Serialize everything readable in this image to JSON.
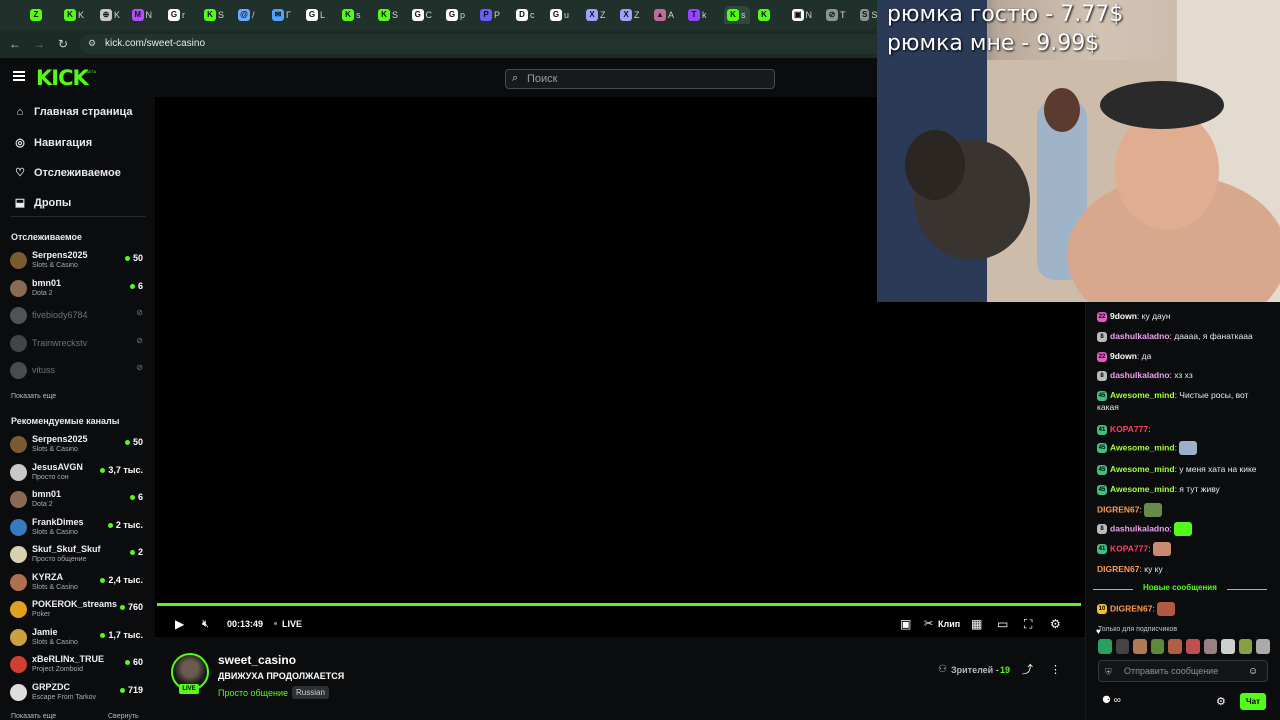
{
  "browser": {
    "url": "kick.com/sweet-casino",
    "tabs": [
      {
        "icon": "Z",
        "label": "",
        "color": "#53fc18"
      },
      {
        "icon": "K",
        "label": "K",
        "color": "#53fc18"
      },
      {
        "icon": "⊕",
        "label": "K",
        "color": "#c9c9c9"
      },
      {
        "icon": "M",
        "label": "N",
        "color": "#b44fff"
      },
      {
        "icon": "G",
        "label": "r",
        "color": "#ffffff"
      },
      {
        "icon": "K",
        "label": "S",
        "color": "#53fc18"
      },
      {
        "icon": "@",
        "label": "/",
        "color": "#6aa9ff"
      },
      {
        "icon": "✉",
        "label": "Г",
        "color": "#4fa3ff"
      },
      {
        "icon": "G",
        "label": "L",
        "color": "#ffffff"
      },
      {
        "icon": "K",
        "label": "s",
        "color": "#53fc18"
      },
      {
        "icon": "K",
        "label": "S",
        "color": "#53fc18"
      },
      {
        "icon": "G",
        "label": "C",
        "color": "#ffffff"
      },
      {
        "icon": "G",
        "label": "p",
        "color": "#ffffff"
      },
      {
        "icon": "P",
        "label": "P",
        "color": "#6a5cff"
      },
      {
        "icon": "D",
        "label": "c",
        "color": "#ffffff"
      },
      {
        "icon": "G",
        "label": "u",
        "color": "#ffffff"
      },
      {
        "icon": "X",
        "label": "Z",
        "color": "#9aa4ff"
      },
      {
        "icon": "X",
        "label": "Z",
        "color": "#9aa4ff"
      },
      {
        "icon": "▲",
        "label": "A",
        "color": "#c26aa0"
      },
      {
        "icon": "T",
        "label": "k",
        "color": "#9146ff"
      },
      {
        "icon": "K",
        "label": "s",
        "color": "#53fc18"
      },
      {
        "icon": "K",
        "label": "",
        "color": "#53fc18"
      },
      {
        "icon": "▣",
        "label": "N",
        "color": "#ffffff"
      },
      {
        "icon": "⊘",
        "label": "T",
        "color": "#8e9297"
      },
      {
        "icon": "S",
        "label": "St",
        "color": "#8e9297"
      }
    ]
  },
  "header": {
    "logo": "KICK",
    "logo_sub": "BETA",
    "search_placeholder": "Поиск"
  },
  "sidebar": {
    "nav": [
      {
        "label": "Главная страница",
        "icon": "⌂"
      },
      {
        "label": "Навигация",
        "icon": "◎"
      },
      {
        "label": "Отслеживаемое",
        "icon": "♡"
      },
      {
        "label": "Дропы",
        "icon": "⬓"
      }
    ],
    "following_title": "Отслеживаемое",
    "following": [
      {
        "name": "Serpens2025",
        "category": "Slots & Casino",
        "viewers": "50",
        "online": true,
        "color": "#7a5a30"
      },
      {
        "name": "bmn01",
        "category": "Dota 2",
        "viewers": "6",
        "online": true,
        "color": "#8a6a55"
      },
      {
        "name": "fivebiody6784",
        "category": "",
        "viewers": "⊘",
        "online": false,
        "color": "#bbbbbb"
      },
      {
        "name": "Trainwreckstv",
        "category": "",
        "viewers": "⊘",
        "online": false,
        "color": "#999999"
      },
      {
        "name": "vituss",
        "category": "",
        "viewers": "⊘",
        "online": false,
        "color": "#aaaaaa"
      }
    ],
    "show_more": "Показать еще",
    "recommended_title": "Рекомендуемые каналы",
    "recommended": [
      {
        "name": "Serpens2025",
        "category": "Slots & Casino",
        "viewers": "50",
        "color": "#7a5a30"
      },
      {
        "name": "JesusAVGN",
        "category": "Просто сон",
        "viewers": "3,7 тыс.",
        "color": "#c9c9c9"
      },
      {
        "name": "bmn01",
        "category": "Dota 2",
        "viewers": "6",
        "color": "#8a6a55"
      },
      {
        "name": "FrankDimes",
        "category": "Slots & Casino",
        "viewers": "2 тыс.",
        "color": "#3a78c0"
      },
      {
        "name": "Skuf_Skuf_Skuf",
        "category": "Просто общение",
        "viewers": "2",
        "color": "#d9d0b0"
      },
      {
        "name": "KYRZA",
        "category": "Slots & Casino",
        "viewers": "2,4 тыс.",
        "color": "#b07050"
      },
      {
        "name": "POKEROK_streams",
        "category": "Poker",
        "viewers": "760",
        "color": "#e0a020"
      },
      {
        "name": "Jamie",
        "category": "Slots & Casino",
        "viewers": "1,7 тыс.",
        "color": "#caa040"
      },
      {
        "name": "xBeRLINx_TRUE",
        "category": "Project Zomboid",
        "viewers": "60",
        "color": "#d04030"
      },
      {
        "name": "GRPZDC",
        "category": "Escape From Tarkov",
        "viewers": "719",
        "color": "#dddddd"
      }
    ],
    "bottom_left": "Показать еще",
    "bottom_right": "Свернуть"
  },
  "player": {
    "time": "00:13:49",
    "live_label": "LIVE",
    "clip_label": "Клип"
  },
  "stream": {
    "streamer": "sweet_casino",
    "live_badge": "LIVE",
    "title": "ДВИЖУХА ПРОДОЛЖАЕТСЯ",
    "category": "Просто общение",
    "language": "Russian",
    "viewers_label": "Зрителей -",
    "viewers_count": "19"
  },
  "overlay": {
    "line1": "рюмка гостю - 7.77$",
    "line2": "рюмка мне - 9.99$"
  },
  "chat": {
    "messages": [
      {
        "badge": "22",
        "badge_color": "#e05cc0",
        "user": "9down",
        "user_color": "#ffffff",
        "text": "ку даун"
      },
      {
        "badge": "8",
        "badge_color": "#bbbbbb",
        "user": "dashulkaladno",
        "user_color": "#f0a0f0",
        "text": "даааа, я фанаткааа"
      },
      {
        "badge": "22",
        "badge_color": "#e05cc0",
        "user": "9down",
        "user_color": "#ffffff",
        "text": "да"
      },
      {
        "badge": "8",
        "badge_color": "#bbbbbb",
        "user": "dashulkaladno",
        "user_color": "#f0a0f0",
        "text": "хз хз"
      },
      {
        "badge": "45",
        "badge_color": "#40c080",
        "user": "Awesome_mind",
        "user_color": "#a6ff3a",
        "text": "Чистые росы, вот какая"
      },
      {
        "badge": "41",
        "badge_color": "#40c080",
        "user": "KOPA777",
        "user_color": "#ff4060",
        "text": ""
      },
      {
        "badge": "45",
        "badge_color": "#40c080",
        "user": "Awesome_mind",
        "user_color": "#a6ff3a",
        "text": ""
      },
      {
        "badge": "45",
        "badge_color": "#40c080",
        "user": "Awesome_mind",
        "user_color": "#a6ff3a",
        "text": "у меня хата на кике"
      },
      {
        "badge": "45",
        "badge_color": "#40c080",
        "user": "Awesome_mind",
        "user_color": "#a6ff3a",
        "text": "я тут живу"
      },
      {
        "badge": "",
        "badge_color": "",
        "user": "DIGREN67",
        "user_color": "#ff9a50",
        "text": ""
      },
      {
        "badge": "8",
        "badge_color": "#bbbbbb",
        "user": "dashulkaladno",
        "user_color": "#f0a0f0",
        "text": ""
      },
      {
        "badge": "41",
        "badge_color": "#40c080",
        "user": "KOPA777",
        "user_color": "#ff4060",
        "text": ""
      },
      {
        "badge": "",
        "badge_color": "",
        "user": "DIGREN67",
        "user_color": "#ff9a50",
        "text": "ку ку"
      },
      {
        "badge": "10",
        "badge_color": "#f0c020",
        "user": "DIGREN67",
        "user_color": "#ff9a50",
        "text": ""
      }
    ],
    "new_messages": "Новые сообщения",
    "subs_only": "Только для подписчиков",
    "input_placeholder": "Отправить сообщение",
    "send_label": "Чат",
    "points": "∞"
  }
}
